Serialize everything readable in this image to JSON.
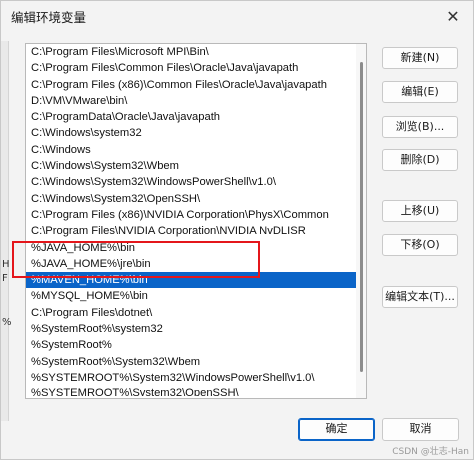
{
  "window": {
    "title": "编辑环境变量"
  },
  "paths": [
    "C:\\Program Files\\Microsoft MPI\\Bin\\",
    "C:\\Program Files\\Common Files\\Oracle\\Java\\javapath",
    "C:\\Program Files (x86)\\Common Files\\Oracle\\Java\\javapath",
    "D:\\VM\\VMware\\bin\\",
    "C:\\ProgramData\\Oracle\\Java\\javapath",
    "C:\\Windows\\system32",
    "C:\\Windows",
    "C:\\Windows\\System32\\Wbem",
    "C:\\Windows\\System32\\WindowsPowerShell\\v1.0\\",
    "C:\\Windows\\System32\\OpenSSH\\",
    "C:\\Program Files (x86)\\NVIDIA Corporation\\PhysX\\Common",
    "C:\\Program Files\\NVIDIA Corporation\\NVIDIA NvDLISR",
    "%JAVA_HOME%\\bin",
    "%JAVA_HOME%\\jre\\bin",
    "%MAVEN_HOME%\\bin",
    "%MYSQL_HOME%\\bin",
    "C:\\Program Files\\dotnet\\",
    "%SystemRoot%\\system32",
    "%SystemRoot%",
    "%SystemRoot%\\System32\\Wbem",
    "%SYSTEMROOT%\\System32\\WindowsPowerShell\\v1.0\\",
    "%SYSTEMROOT%\\System32\\OpenSSH\\"
  ],
  "selected_index": 14,
  "buttons": {
    "new": "新建(N)",
    "edit": "编辑(E)",
    "browse": "浏览(B)...",
    "delete": "删除(D)",
    "move_up": "上移(U)",
    "move_down": "下移(O)",
    "edit_text": "编辑文本(T)...",
    "ok": "确定",
    "cancel": "取消"
  },
  "watermark": "CSDN @壮志-Han",
  "edge_marks": [
    "H",
    "F",
    "%"
  ],
  "colors": {
    "selection": "#0a64c8",
    "highlight_box": "#e4161b"
  }
}
